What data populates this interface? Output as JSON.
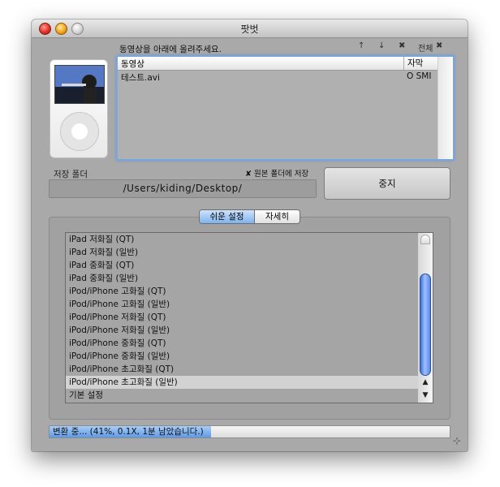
{
  "window": {
    "title": "팟벗"
  },
  "upload": {
    "prompt": "동영상을 아래에 올려주세요.",
    "icons": {
      "move_up": "↑",
      "move_down": "↓",
      "remove": "✖",
      "clear_all_label": "전체",
      "clear_all_icon": "✖"
    },
    "list": {
      "headers": [
        "동영상",
        "자막"
      ],
      "rows": [
        {
          "name": "테스트.avi",
          "subtitle": "O SMI"
        }
      ]
    }
  },
  "save": {
    "label": "저장 폴더",
    "orig_folder_check": "✘ 원본 폴더에 저장",
    "path": "/Users/kiding/Desktop/"
  },
  "stop_button": "중지",
  "mode_tabs": {
    "easy": "쉬운 설정",
    "detail": "자세히"
  },
  "presets": {
    "items": [
      "iPad 저화질 (QT)",
      "iPad 저화질 (일반)",
      "iPad 중화질 (QT)",
      "iPad 중화질 (일반)",
      "iPod/iPhone 고화질 (QT)",
      "iPod/iPhone 고화질 (일반)",
      "iPod/iPhone 저화질 (QT)",
      "iPod/iPhone 저화질 (일반)",
      "iPod/iPhone 중화질 (QT)",
      "iPod/iPhone 중화질 (일반)",
      "iPod/iPhone 초고화질 (QT)",
      "iPod/iPhone 초고화질 (일반)",
      "기본 설정"
    ],
    "selected_index": 11
  },
  "progress": {
    "text": "변환 중... (41%, 0.1X, 1분 남았습니다.)",
    "fraction": 0.41
  },
  "colors": {
    "focus_ring": "#7aa6e0",
    "progress_fill": "#5e99e6",
    "scroll_thumb": "#3f6fd6"
  }
}
